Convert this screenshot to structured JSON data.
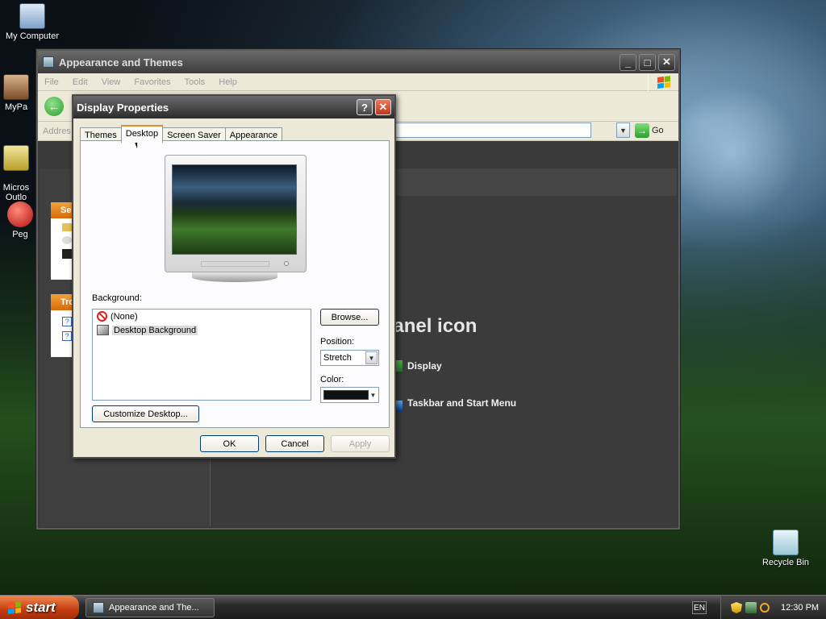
{
  "desktop": {
    "icons": [
      {
        "label": "My Computer"
      },
      {
        "label": "MyPa"
      },
      {
        "label": "Micros\nOutlo"
      },
      {
        "label": "Peg"
      },
      {
        "label": "Recycle Bin"
      }
    ]
  },
  "explorer": {
    "title": "Appearance and Themes",
    "menu": [
      "File",
      "Edit",
      "View",
      "Favorites",
      "Tools",
      "Help"
    ],
    "address_label": "Addres",
    "go_label": "Go",
    "left_pane": {
      "see_also_head": "Se",
      "troubleshooters_head": "Tro"
    },
    "main_title": "l Panel icon",
    "links": [
      "Display",
      "Taskbar and Start Menu"
    ]
  },
  "dialog": {
    "title": "Display Properties",
    "help_glyph": "?",
    "close_glyph": "✕",
    "tabs": [
      "Themes",
      "Desktop",
      "Screen Saver",
      "Appearance"
    ],
    "active_tab": "Desktop",
    "background_label": "Background:",
    "background_items": [
      "(None)",
      "Desktop Background"
    ],
    "selected_background": "Desktop Background",
    "browse_label": "Browse...",
    "position_label": "Position:",
    "position_value": "Stretch",
    "color_label": "Color:",
    "color_value": "#111111",
    "customize_label": "Customize Desktop...",
    "ok_label": "OK",
    "cancel_label": "Cancel",
    "apply_label": "Apply"
  },
  "taskbar": {
    "start_label": "start",
    "task_item_label": "Appearance and The...",
    "language": "EN",
    "clock": "12:30 PM"
  }
}
